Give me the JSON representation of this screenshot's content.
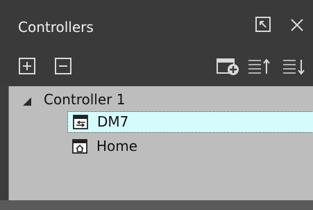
{
  "panel": {
    "title": "Controllers",
    "undock_icon": "undock-icon",
    "close_icon": "close-icon"
  },
  "toolbar": {
    "add_icon": "plus-box-icon",
    "remove_icon": "minus-box-icon",
    "new_window_icon": "new-window-icon",
    "move_up_icon": "list-move-up-icon",
    "move_down_icon": "list-move-down-icon"
  },
  "tree": {
    "root": {
      "label": "Controller 1",
      "expanded": true
    },
    "children": [
      {
        "label": "DM7",
        "icon": "device-window-icon",
        "selected": true
      },
      {
        "label": "Home",
        "icon": "home-window-icon",
        "selected": false
      }
    ]
  },
  "colors": {
    "panel_bg": "#3a3a3a",
    "tree_bg": "#bdbdbd",
    "selection_bg": "#d6fbfd",
    "icon_stroke": "#d9d9d9"
  }
}
